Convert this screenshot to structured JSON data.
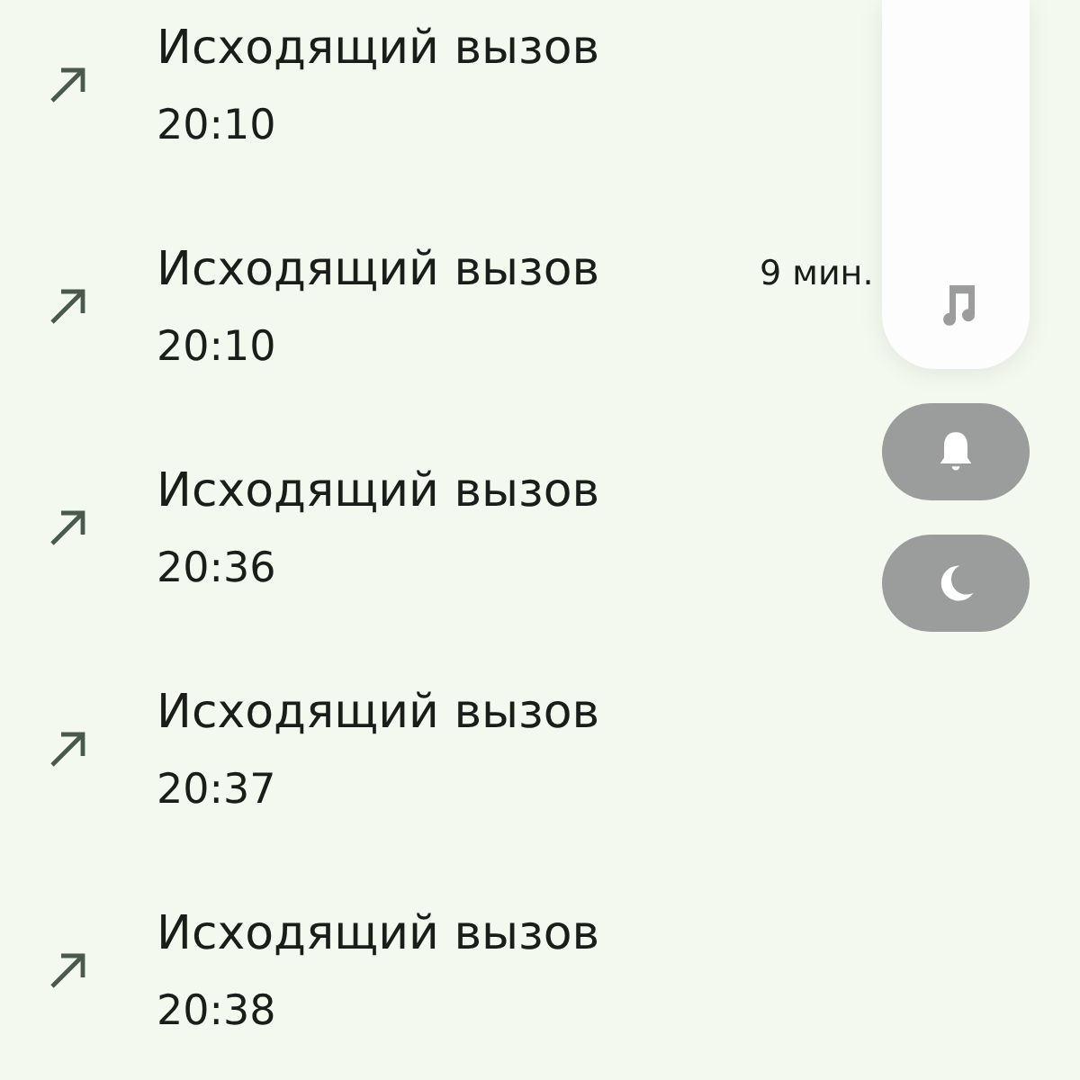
{
  "calls": [
    {
      "kind": "outgoing",
      "title": "Исходящий вызов",
      "time": "20:10"
    },
    {
      "kind": "outgoing",
      "title": "Исходящий вызов",
      "time": "20:10",
      "duration": "9 мин."
    },
    {
      "kind": "outgoing",
      "title": "Исходящий вызов",
      "time": "20:36"
    },
    {
      "kind": "outgoing",
      "title": "Исходящий вызов",
      "time": "20:37"
    },
    {
      "kind": "outgoing",
      "title": "Исходящий вызов",
      "time": "20:38"
    }
  ],
  "volume_panel": {
    "slider": {
      "kind": "media",
      "level": 0
    },
    "mode_buttons": [
      {
        "kind": "ring"
      },
      {
        "kind": "sleep"
      }
    ]
  }
}
